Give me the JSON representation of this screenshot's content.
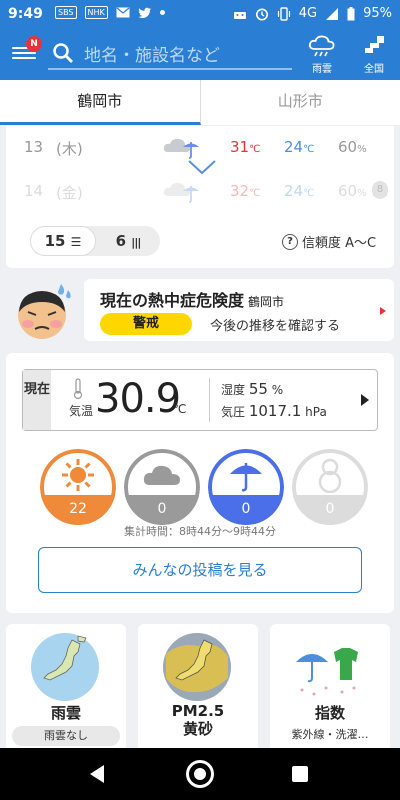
{
  "status_bar": {
    "time": "9:49",
    "tags": [
      "SBS",
      "NHK"
    ],
    "network": "4G",
    "battery": "95%"
  },
  "header": {
    "notification_badge": "N",
    "search_placeholder": "地名・施設名など",
    "rain_cloud_label": "雨雲",
    "nationwide_label": "全国"
  },
  "tabs": [
    {
      "label": "鶴岡市",
      "active": true
    },
    {
      "label": "山形市",
      "active": false
    }
  ],
  "forecast": {
    "rows": [
      {
        "day": "13",
        "weekday": "(木)",
        "high": "31",
        "low": "24",
        "unit": "℃",
        "pop": "60",
        "pop_unit": "%"
      },
      {
        "day": "14",
        "weekday": "(金)",
        "high": "32",
        "low": "24",
        "unit": "℃",
        "pop": "60",
        "pop_unit": "%"
      }
    ],
    "scroll_indicator": "8",
    "toggle_15": "15",
    "toggle_6": "6",
    "reliability_label": "信頼度 A〜C"
  },
  "heat": {
    "title": "現在の熱中症危険度",
    "place": "鶴岡市",
    "level": "警戒",
    "link": "今後の推移を確認する"
  },
  "current": {
    "label": "現在",
    "temp_label": "気温",
    "temp": "30.9",
    "temp_unit": "℃",
    "humidity_label": "湿度",
    "humidity": "55",
    "humidity_unit": "%",
    "pressure_label": "気圧",
    "pressure": "1017.1",
    "pressure_unit": "hPa"
  },
  "posts": {
    "counts": [
      {
        "kind": "sunny",
        "value": "22",
        "color": "#ef8a3a"
      },
      {
        "kind": "cloudy",
        "value": "0",
        "color": "#9a9a9a"
      },
      {
        "kind": "rain",
        "value": "0",
        "color": "#4a6fe8"
      },
      {
        "kind": "snow",
        "value": "0",
        "color": "#dcdcdc"
      }
    ],
    "aggregation": "集計時間：8時44分〜9時44分",
    "see_posts": "みんなの投稿を見る"
  },
  "tiles": [
    {
      "name": "雨雲",
      "sub": "雨雲なし"
    },
    {
      "name_line1": "PM2.5",
      "name_line2": "黄砂"
    },
    {
      "name": "指数",
      "sub": "紫外線・洗濯…"
    }
  ],
  "colors": {
    "brand": "#2a7fd4",
    "high_temp": "#e8333a",
    "low_temp": "#4a8fe0",
    "warning": "#ffd700"
  }
}
